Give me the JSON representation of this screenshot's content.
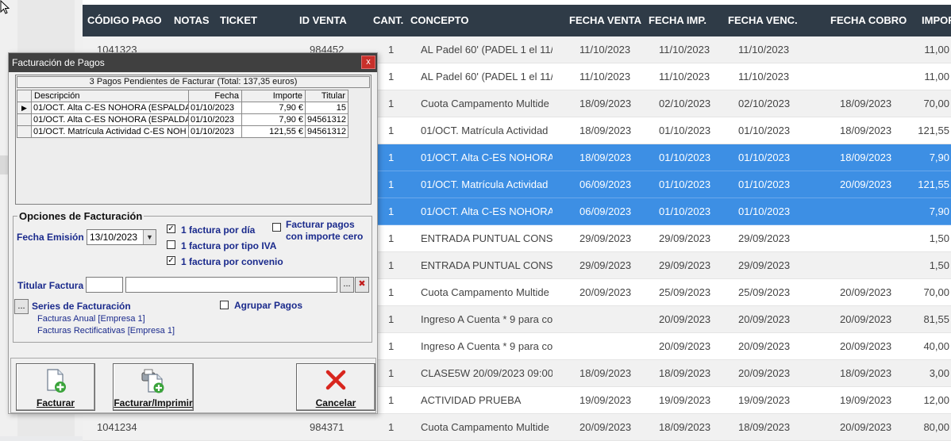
{
  "grid": {
    "headers": [
      "CÓDIGO PAGO",
      "NOTAS",
      "TICKET",
      "ID VENTA",
      "CANT.",
      "CONCEPTO",
      "FECHA VENTA",
      "FECHA IMP.",
      "FECHA VENC.",
      "FECHA COBRO",
      "IMPOR"
    ],
    "rows": [
      {
        "code": "1041323",
        "idventa": "984452",
        "cant": "1",
        "concepto": "AL Padel 60' (PADEL 1 el 11/1",
        "fventa": "11/10/2023",
        "fimp": "11/10/2023",
        "fvenc": "11/10/2023",
        "fcobro": "",
        "importe": "11,00"
      },
      {
        "code": "",
        "idventa": "",
        "cant": "1",
        "concepto": "AL Padel 60' (PADEL 1 el 11/1",
        "fventa": "11/10/2023",
        "fimp": "11/10/2023",
        "fvenc": "11/10/2023",
        "fcobro": "",
        "importe": "11,00"
      },
      {
        "code": "",
        "idventa": "",
        "cant": "1",
        "concepto": "Cuota Campamento Multide",
        "fventa": "18/09/2023",
        "fimp": "02/10/2023",
        "fvenc": "02/10/2023",
        "fcobro": "18/09/2023",
        "importe": "70,00"
      },
      {
        "code": "",
        "idventa": "",
        "cant": "1",
        "concepto": "01/OCT. Matrícula Actividad",
        "fventa": "18/09/2023",
        "fimp": "01/10/2023",
        "fvenc": "01/10/2023",
        "fcobro": "18/09/2023",
        "importe": "121,55"
      },
      {
        "code": "",
        "idventa": "",
        "cant": "1",
        "concepto": "01/OCT. Alta C-ES NOHORA",
        "fventa": "18/09/2023",
        "fimp": "01/10/2023",
        "fvenc": "01/10/2023",
        "fcobro": "18/09/2023",
        "importe": "7,90"
      },
      {
        "code": "",
        "idventa": "",
        "cant": "1",
        "concepto": "01/OCT. Matrícula Actividad",
        "fventa": "06/09/2023",
        "fimp": "01/10/2023",
        "fvenc": "01/10/2023",
        "fcobro": "20/09/2023",
        "importe": "121,55"
      },
      {
        "code": "",
        "idventa": "",
        "cant": "1",
        "concepto": "01/OCT. Alta C-ES NOHORA",
        "fventa": "06/09/2023",
        "fimp": "01/10/2023",
        "fvenc": "01/10/2023",
        "fcobro": "",
        "importe": "7,90"
      },
      {
        "code": "",
        "idventa": "",
        "cant": "1",
        "concepto": "ENTRADA PUNTUAL CONSU",
        "fventa": "29/09/2023",
        "fimp": "29/09/2023",
        "fvenc": "29/09/2023",
        "fcobro": "",
        "importe": "1,50"
      },
      {
        "code": "",
        "idventa": "",
        "cant": "1",
        "concepto": "ENTRADA PUNTUAL CONSU",
        "fventa": "29/09/2023",
        "fimp": "29/09/2023",
        "fvenc": "29/09/2023",
        "fcobro": "",
        "importe": "1,50"
      },
      {
        "code": "",
        "idventa": "",
        "cant": "1",
        "concepto": "Cuota Campamento Multide",
        "fventa": "20/09/2023",
        "fimp": "25/09/2023",
        "fvenc": "25/09/2023",
        "fcobro": "20/09/2023",
        "importe": "70,00"
      },
      {
        "code": "",
        "idventa": "",
        "cant": "1",
        "concepto": "Ingreso A Cuenta * 9  para co",
        "fventa": "",
        "fimp": "20/09/2023",
        "fvenc": "20/09/2023",
        "fcobro": "20/09/2023",
        "importe": "81,55"
      },
      {
        "code": "",
        "idventa": "",
        "cant": "1",
        "concepto": "Ingreso A Cuenta * 9  para co",
        "fventa": "",
        "fimp": "20/09/2023",
        "fvenc": "20/09/2023",
        "fcobro": "20/09/2023",
        "importe": "40,00"
      },
      {
        "code": "",
        "idventa": "",
        "cant": "1",
        "concepto": "CLASE5W 20/09/2023 09:00-",
        "fventa": "18/09/2023",
        "fimp": "18/09/2023",
        "fvenc": "20/09/2023",
        "fcobro": "18/09/2023",
        "importe": "3,00"
      },
      {
        "code": "",
        "idventa": "",
        "cant": "1",
        "concepto": "ACTIVIDAD PRUEBA",
        "fventa": "19/09/2023",
        "fimp": "19/09/2023",
        "fvenc": "19/09/2023",
        "fcobro": "19/09/2023",
        "importe": "12,00"
      },
      {
        "code": "1041234",
        "idventa": "984371",
        "cant": "1",
        "concepto": "Cuota Campamento Multide",
        "fventa": "20/09/2023",
        "fimp": "18/09/2023",
        "fvenc": "18/09/2023",
        "fcobro": "20/09/2023",
        "importe": "80,00"
      }
    ]
  },
  "dialog": {
    "title": "Facturación de Pagos",
    "close_label": "x",
    "pending": {
      "caption": "3 Pagos Pendientes de Facturar (Total: 137,35 euros)",
      "columns": [
        "Descripción",
        "Fecha",
        "Importe",
        "Titular"
      ],
      "rows": [
        {
          "desc": "01/OCT. Alta C-ES NOHORA (ESPALDA",
          "fecha": "01/10/2023",
          "importe": "7,90 €",
          "titular": "15"
        },
        {
          "desc": "01/OCT. Alta C-ES NOHORA (ESPALDA",
          "fecha": "01/10/2023",
          "importe": "7,90 €",
          "titular": "94561312"
        },
        {
          "desc": "01/OCT. Matrícula Actividad C-ES NOH",
          "fecha": "01/10/2023",
          "importe": "121,55 €",
          "titular": "94561312"
        }
      ]
    },
    "opciones": {
      "legend": "Opciones de Facturación",
      "fecha_emision_label": "Fecha Emisión",
      "fecha_emision_value": "13/10/2023",
      "chk_factura_dia": "1 factura por día",
      "chk_factura_iva": "1 factura por tipo IVA",
      "chk_factura_convenio": "1 factura por convenio",
      "chk_importe_cero_1": "Facturar pagos",
      "chk_importe_cero_2": "con importe cero",
      "titular_label": "Titular Factura",
      "titular_code": "",
      "titular_name": "",
      "browse_label": "...",
      "delete_label": "✖",
      "series_btn": "...",
      "series_label": "Series de Facturación",
      "series_items": [
        "Facturas Anual [Empresa 1]",
        "Facturas Rectificativas [Empresa 1]"
      ],
      "agrupar_label": "Agrupar Pagos"
    },
    "buttons": {
      "facturar": "Facturar",
      "facturar_imprimir": "Facturar/Imprimir",
      "cancelar": "Cancelar"
    }
  },
  "colors": {
    "header_bg": "#2f3b47",
    "selected_row": "#3d8fe4",
    "titlebar": "#404040",
    "close": "#c8302a",
    "navy_text": "#1a2a8c"
  }
}
